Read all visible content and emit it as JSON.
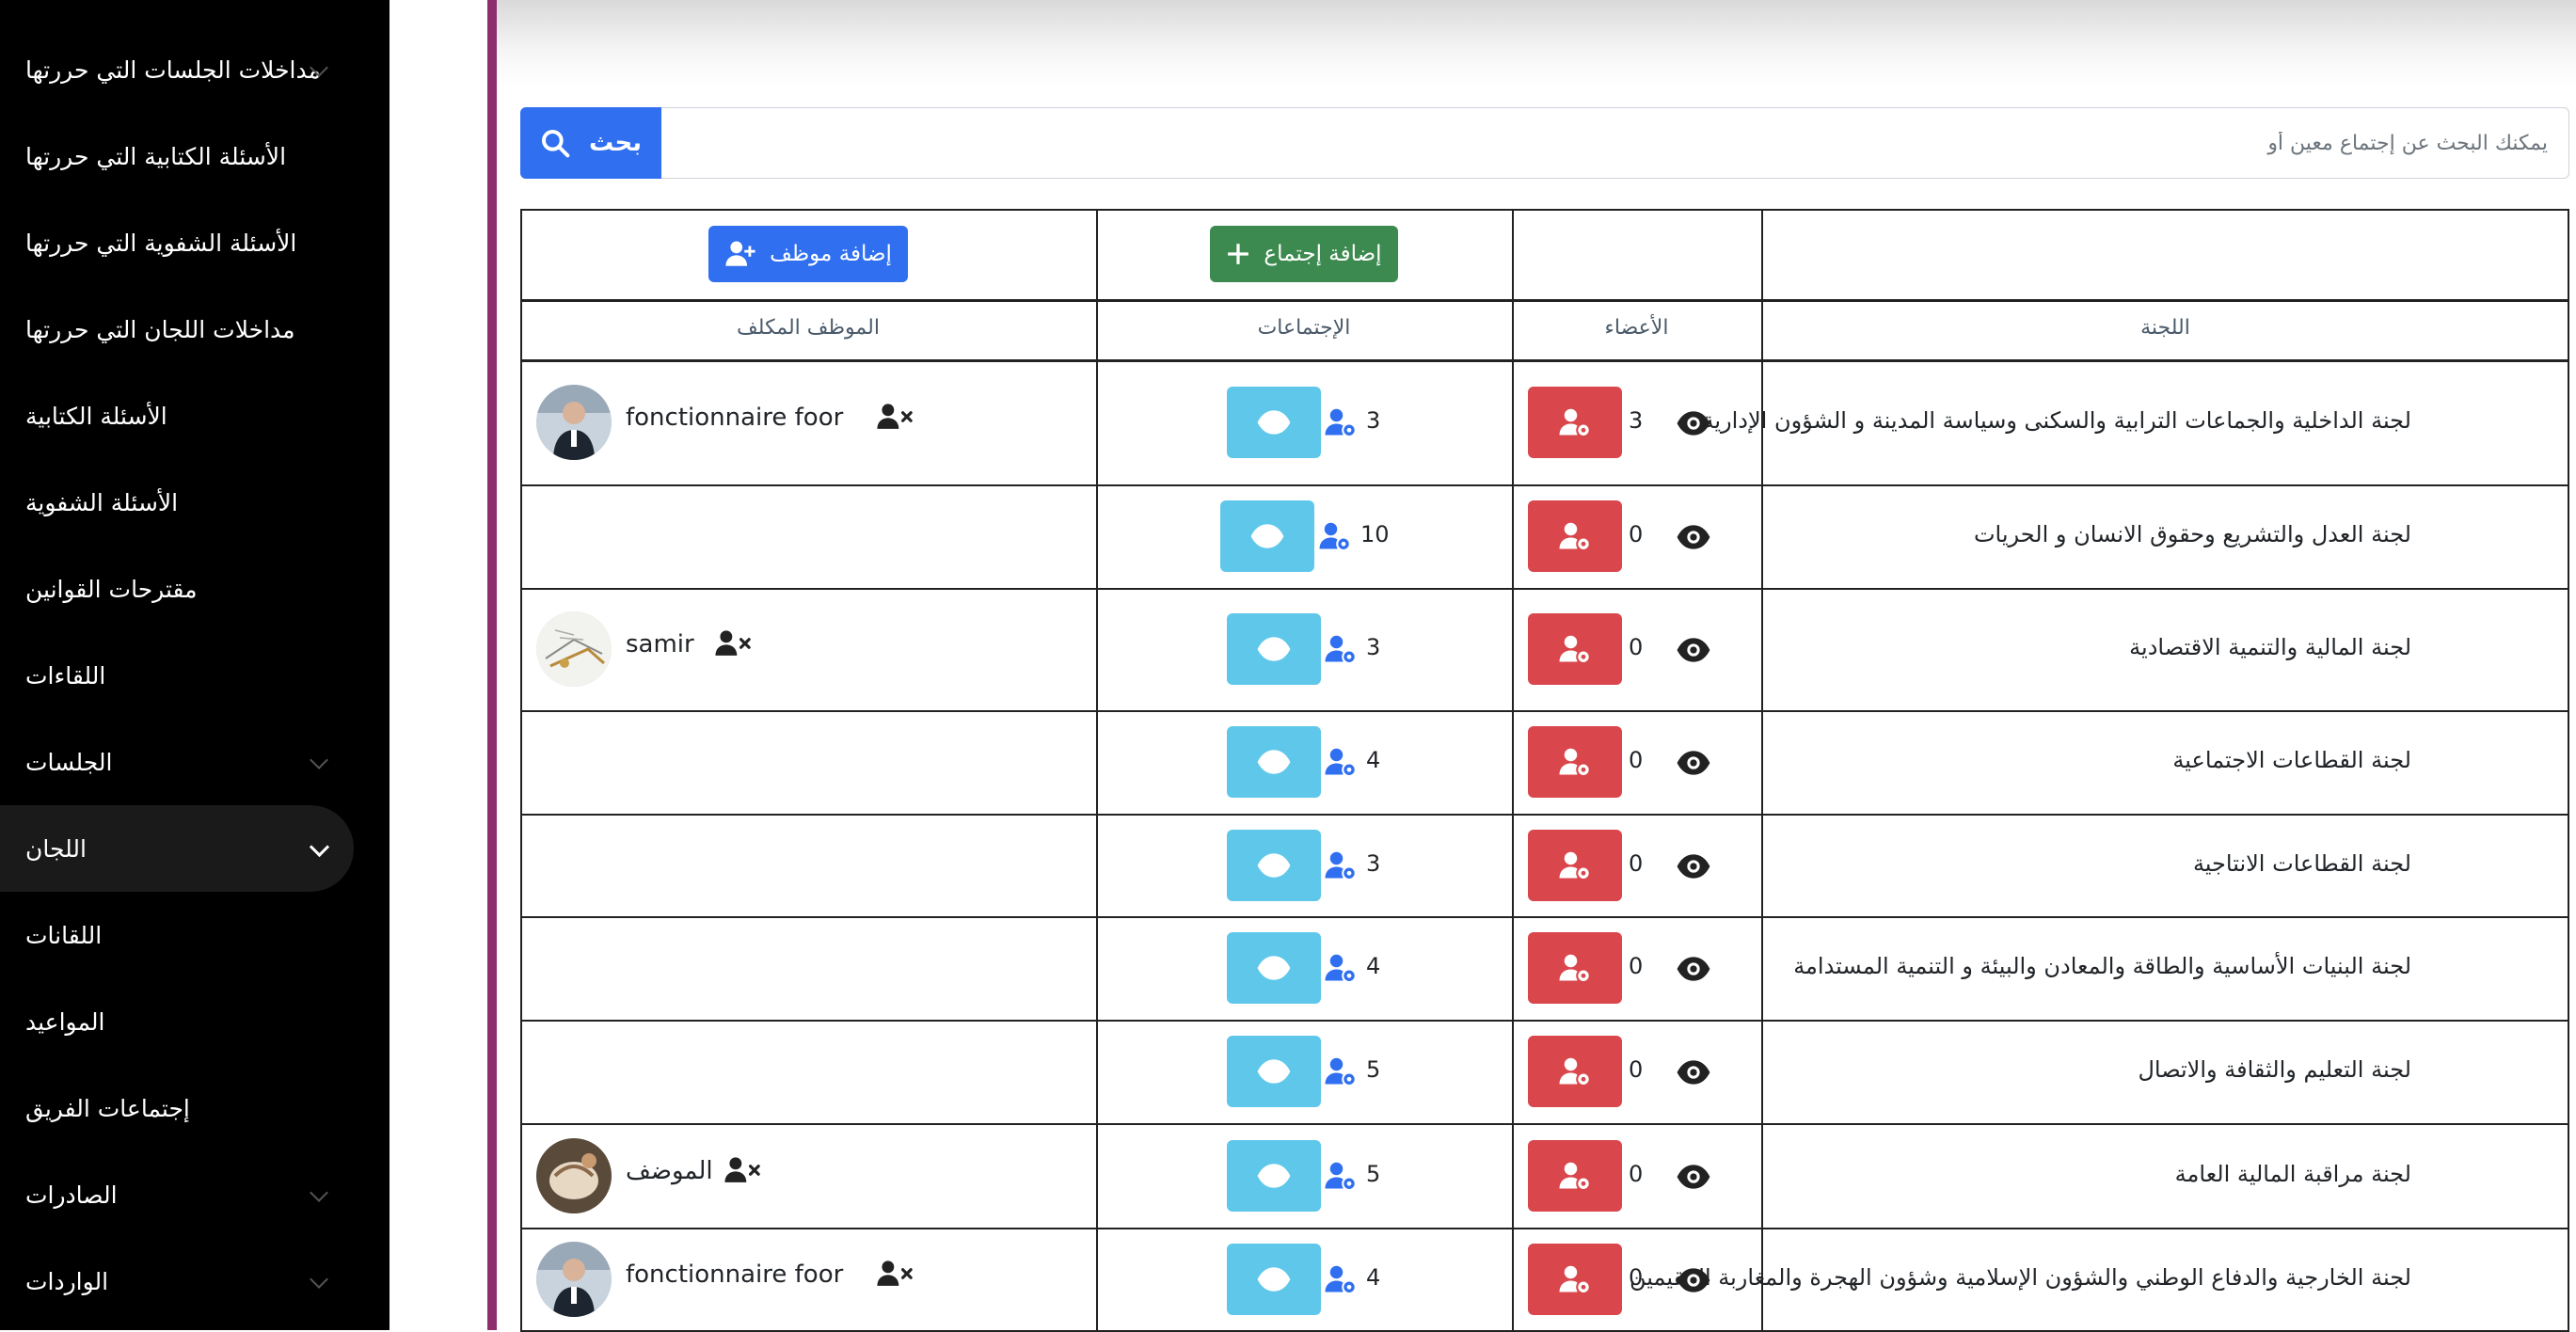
{
  "sidebar": {
    "items": [
      {
        "label": "مداخلات الجلسات التي حررتها",
        "chevron": true
      },
      {
        "label": "الأسئلة الكتابية التي حررتها",
        "chevron": false
      },
      {
        "label": "الأسئلة الشفوية التي حررتها",
        "chevron": false
      },
      {
        "label": "مداخلات اللجان التي حررتها",
        "chevron": false
      },
      {
        "label": "الأسئلة الكتابية",
        "chevron": false
      },
      {
        "label": "الأسئلة الشفوية",
        "chevron": false
      },
      {
        "label": "مقترحات القوانين",
        "chevron": false
      },
      {
        "label": "اللقاءات",
        "chevron": false
      },
      {
        "label": "الجلسات",
        "chevron": true
      },
      {
        "label": "اللجان",
        "chevron": true,
        "active": true
      },
      {
        "label": "اللقانات",
        "chevron": false
      },
      {
        "label": "المواعيد",
        "chevron": false
      },
      {
        "label": "إجتماعات الفريق",
        "chevron": false
      },
      {
        "label": "الصادرات",
        "chevron": true
      },
      {
        "label": "الواردات",
        "chevron": true
      }
    ]
  },
  "search": {
    "button_label": "بحث",
    "placeholder": "يمكنك البحث عن إجتماع معين أو",
    "value": ""
  },
  "toolbar": {
    "add_employee_label": "إضافة موظف",
    "add_meeting_label": "إضافة إجتماع"
  },
  "table": {
    "headers": {
      "employee": "الموظف المكلف",
      "meetings": "الإجتماعات",
      "members": "الأعضاء",
      "committee": "اللجنة"
    },
    "rows": [
      {
        "committee": "لجنة الداخلية والجماعات الترابية والسكنى وسياسة المدينة و الشؤون الإدارية",
        "members": "3",
        "meetings": "3",
        "employee": "fonctionnaire foor",
        "avatar": "person"
      },
      {
        "committee": "لجنة العدل والتشريع وحقوق الانسان و الحريات",
        "members": "0",
        "meetings": "10",
        "employee": "",
        "avatar": ""
      },
      {
        "committee": "لجنة المالية والتنمية الاقتصادية",
        "members": "0",
        "meetings": "3",
        "employee": "samir",
        "avatar": "sketch"
      },
      {
        "committee": "لجنة القطاعات الاجتماعية",
        "members": "0",
        "meetings": "4",
        "employee": "",
        "avatar": ""
      },
      {
        "committee": "لجنة القطاعات الانتاجية",
        "members": "0",
        "meetings": "3",
        "employee": "",
        "avatar": ""
      },
      {
        "committee": "لجنة البنيات الأساسية والطاقة والمعادن والبيئة و التنمية المستدامة",
        "members": "0",
        "meetings": "4",
        "employee": "",
        "avatar": ""
      },
      {
        "committee": "لجنة التعليم والثقافة والاتصال",
        "members": "0",
        "meetings": "5",
        "employee": "",
        "avatar": ""
      },
      {
        "committee": "لجنة مراقبة المالية العامة",
        "members": "0",
        "meetings": "5",
        "employee": "الموضف",
        "avatar": "hands"
      },
      {
        "committee": "لجنة الخارجية والدفاع الوطني والشؤون الإسلامية وشؤون الهجرة والمغاربة المقيمين بالخارج",
        "members": "0",
        "meetings": "4",
        "employee": "fonctionnaire foor",
        "avatar": "person"
      }
    ]
  },
  "colors": {
    "sidebar_bg": "#000000",
    "accent_purple": "#8e2f6d",
    "primary_blue": "#2f6ff0",
    "success_green": "#3c8a4f",
    "danger_red": "#d9464b",
    "info_cyan": "#5fc8ea"
  },
  "icons": [
    "search-icon",
    "user-plus-icon",
    "plus-icon",
    "eye-icon",
    "user-gear-icon",
    "user-remove-icon",
    "chevron-down-icon"
  ]
}
